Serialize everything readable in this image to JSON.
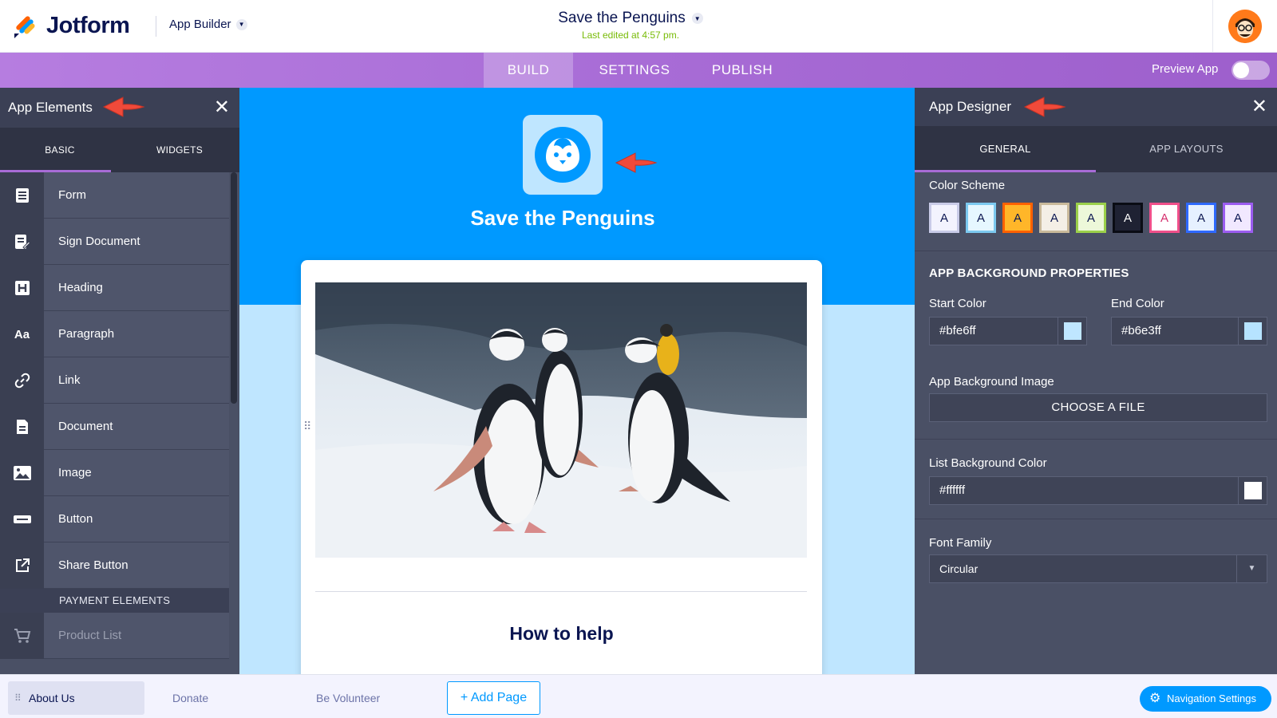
{
  "topbar": {
    "brand": "Jotform",
    "builder_label": "App Builder",
    "app_title": "Save the Penguins",
    "last_edited": "Last edited at 4:57 pm."
  },
  "nav": {
    "tabs": [
      "BUILD",
      "SETTINGS",
      "PUBLISH"
    ],
    "preview_label": "Preview App"
  },
  "left_panel": {
    "title": "App Elements",
    "tabs": [
      "BASIC",
      "WIDGETS"
    ],
    "items": [
      {
        "label": "Form",
        "icon": "form-icon"
      },
      {
        "label": "Sign Document",
        "icon": "sign-document-icon"
      },
      {
        "label": "Heading",
        "icon": "heading-icon"
      },
      {
        "label": "Paragraph",
        "icon": "paragraph-icon"
      },
      {
        "label": "Link",
        "icon": "link-icon"
      },
      {
        "label": "Document",
        "icon": "document-icon"
      },
      {
        "label": "Image",
        "icon": "image-icon"
      },
      {
        "label": "Button",
        "icon": "button-icon"
      },
      {
        "label": "Share Button",
        "icon": "share-icon"
      }
    ],
    "section_label": "PAYMENT ELEMENTS",
    "payment_items": [
      {
        "label": "Product List",
        "icon": "cart-icon"
      }
    ]
  },
  "canvas": {
    "app_name": "Save the Penguins",
    "card_heading": "How to help"
  },
  "right_panel": {
    "title": "App Designer",
    "tabs": [
      "GENERAL",
      "APP LAYOUTS"
    ],
    "color_scheme_label": "Color Scheme",
    "swatch_letter": "A",
    "swatches": [
      {
        "bg": "#f3f3fe",
        "border": "#c9cbe8",
        "fg": "#0a1551"
      },
      {
        "bg": "#e6f7ff",
        "border": "#7cc9f0",
        "fg": "#0a1551"
      },
      {
        "bg": "#ffb629",
        "border": "#ff6100",
        "fg": "#0a1551"
      },
      {
        "bg": "#f4efe6",
        "border": "#c9b99a",
        "fg": "#0a1551"
      },
      {
        "bg": "#edf8d9",
        "border": "#9bd04a",
        "fg": "#0a1551"
      },
      {
        "bg": "#1f2233",
        "border": "#0a0c14",
        "fg": "#ffffff"
      },
      {
        "bg": "#ffffff",
        "border": "#f04f8a",
        "fg": "#d52e6d"
      },
      {
        "bg": "#e6f0ff",
        "border": "#2e69ff",
        "fg": "#0a1551"
      },
      {
        "bg": "#f1e8ff",
        "border": "#9b5cf0",
        "fg": "#0a1551"
      }
    ],
    "bg_props_title": "APP BACKGROUND PROPERTIES",
    "start_color_label": "Start Color",
    "start_color": "#bfe6ff",
    "end_color_label": "End Color",
    "end_color": "#b6e3ff",
    "bg_image_label": "App Background Image",
    "choose_file": "CHOOSE A FILE",
    "list_bg_label": "List Background Color",
    "list_bg_color": "#ffffff",
    "font_family_label": "Font Family",
    "font_family_value": "Circular"
  },
  "bottom": {
    "pages": [
      "About Us",
      "Donate",
      "Be Volunteer"
    ],
    "add_page": "+ Add Page",
    "nav_settings": "Navigation Settings"
  },
  "colors": {
    "brand_purple": "#a86cd6",
    "brand_blue": "#0099ff",
    "panel_dark": "#4a5065",
    "accent_green": "#78bb07",
    "annotation_red": "#f04a3a"
  }
}
